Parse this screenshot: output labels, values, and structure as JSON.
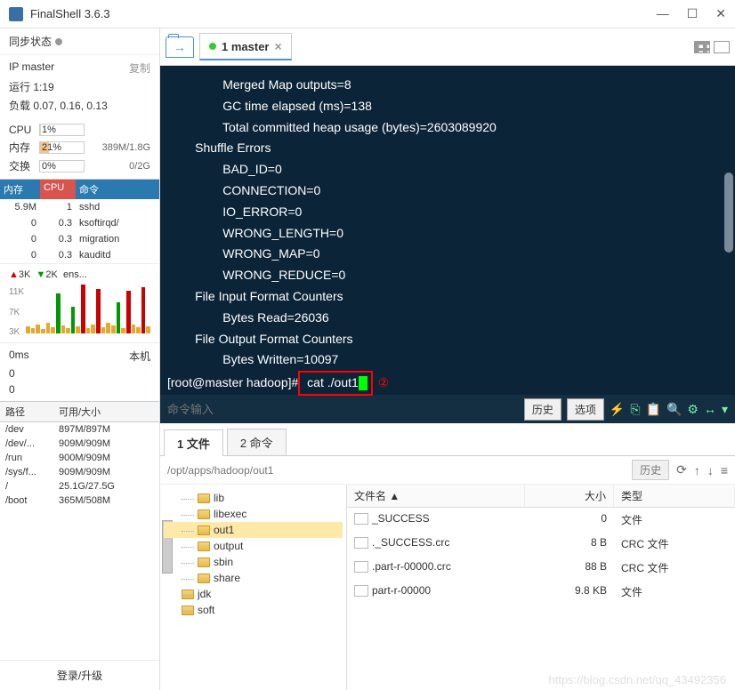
{
  "app": {
    "title": "FinalShell 3.6.3"
  },
  "win_controls": {
    "min": "—",
    "max": "☐",
    "close": "✕"
  },
  "sidebar": {
    "sync_label": "同步状态",
    "ip_label": "IP master",
    "copy_label": "复制",
    "runtime_label": "运行 1:19",
    "load_label": "负载 0.07, 0.16, 0.13",
    "cpu_label": "CPU",
    "cpu_pct": "1%",
    "mem_label": "内存",
    "mem_pct": "21%",
    "mem_detail": "389M/1.8G",
    "swap_label": "交换",
    "swap_pct": "0%",
    "swap_detail": "0/2G",
    "proc_head": {
      "mem": "内存",
      "cpu": "CPU",
      "cmd": "命令"
    },
    "procs": [
      {
        "mem": "5.9M",
        "cpu": "1",
        "name": "sshd"
      },
      {
        "mem": "0",
        "cpu": "0.3",
        "name": "ksoftirqd/"
      },
      {
        "mem": "0",
        "cpu": "0.3",
        "name": "migration"
      },
      {
        "mem": "0",
        "cpu": "0.3",
        "name": "kauditd"
      }
    ],
    "net": {
      "up": "3K",
      "down": "2K",
      "iface": "ens...",
      "y1": "11K",
      "y2": "7K",
      "y3": "3K"
    },
    "perf": {
      "ms": "0ms",
      "host": "本机",
      "v0": "0",
      "v1": "0"
    },
    "disk_head": {
      "path": "路径",
      "size": "可用/大小"
    },
    "disks": [
      {
        "path": "/dev",
        "size": "897M/897M"
      },
      {
        "path": "/dev/...",
        "size": "909M/909M"
      },
      {
        "path": "/run",
        "size": "900M/909M"
      },
      {
        "path": "/sys/f...",
        "size": "909M/909M"
      },
      {
        "path": "/",
        "size": "25.1G/27.5G"
      },
      {
        "path": "/boot",
        "size": "365M/508M"
      }
    ],
    "footer": "登录/升级"
  },
  "tabs": {
    "current": "1 master"
  },
  "terminal": {
    "lines": [
      "                Merged Map outputs=8",
      "                GC time elapsed (ms)=138",
      "                Total committed heap usage (bytes)=2603089920",
      "        Shuffle Errors",
      "                BAD_ID=0",
      "                CONNECTION=0",
      "                IO_ERROR=0",
      "                WRONG_LENGTH=0",
      "                WRONG_MAP=0",
      "                WRONG_REDUCE=0",
      "        File Input Format Counters",
      "                Bytes Read=26036",
      "        File Output Format Counters",
      "                Bytes Written=10097"
    ],
    "prompt": "[root@master hadoop]#",
    "command": " cat ./out1",
    "annotation": "②"
  },
  "cmdbar": {
    "placeholder": "命令输入",
    "history": "历史",
    "options": "选项"
  },
  "filetabs": {
    "t1": "1 文件",
    "t2": "2 命令"
  },
  "pathbar": {
    "path": "/opt/apps/hadoop/out1",
    "history": "历史"
  },
  "tree": [
    {
      "name": "lib",
      "sel": false,
      "lvl": 1
    },
    {
      "name": "libexec",
      "sel": false,
      "lvl": 1
    },
    {
      "name": "out1",
      "sel": true,
      "lvl": 1
    },
    {
      "name": "output",
      "sel": false,
      "lvl": 1
    },
    {
      "name": "sbin",
      "sel": false,
      "lvl": 1
    },
    {
      "name": "share",
      "sel": false,
      "lvl": 1
    },
    {
      "name": "jdk",
      "sel": false,
      "lvl": 0
    },
    {
      "name": "soft",
      "sel": false,
      "lvl": 0
    }
  ],
  "filelist": {
    "head": {
      "name": "文件名 ▲",
      "size": "大小",
      "type": "类型"
    },
    "rows": [
      {
        "name": "_SUCCESS",
        "size": "0",
        "type": "文件"
      },
      {
        "name": "._SUCCESS.crc",
        "size": "8 B",
        "type": "CRC 文件"
      },
      {
        "name": ".part-r-00000.crc",
        "size": "88 B",
        "type": "CRC 文件"
      },
      {
        "name": "part-r-00000",
        "size": "9.8 KB",
        "type": "文件"
      }
    ]
  },
  "watermark": "https://blog.csdn.net/qq_43492356"
}
